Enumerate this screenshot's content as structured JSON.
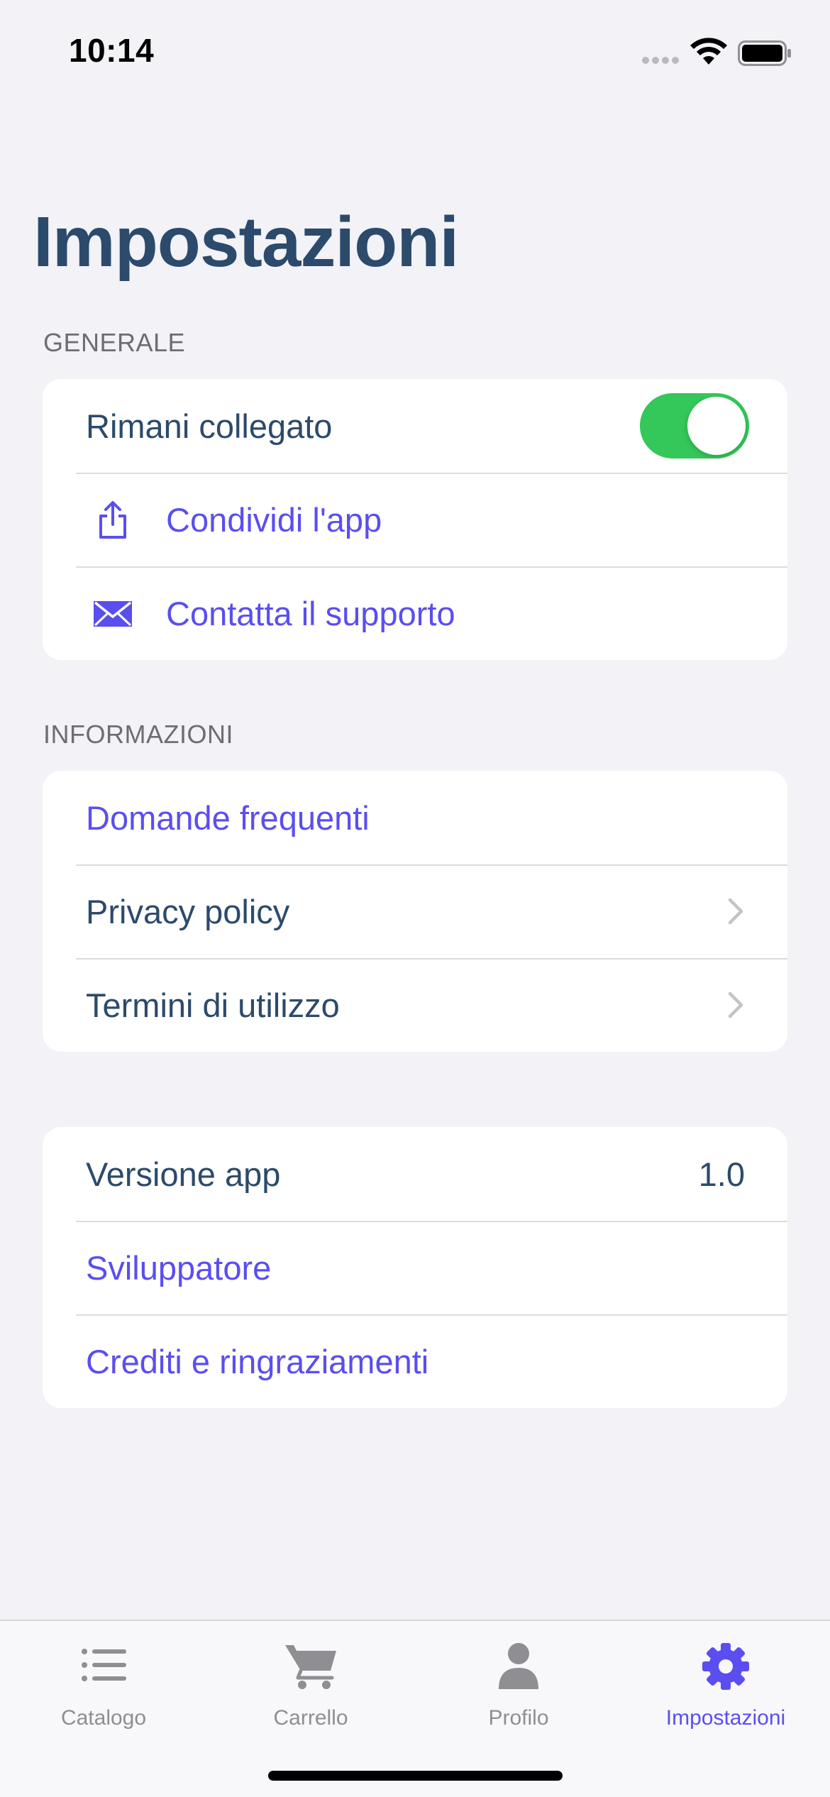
{
  "status_bar": {
    "time": "10:14",
    "icons": [
      "signal-dots-icon",
      "wifi-icon",
      "battery-icon"
    ]
  },
  "page": {
    "title": "Impostazioni"
  },
  "sections": {
    "generale": {
      "header": "GENERALE",
      "stay_logged_in": {
        "label": "Rimani collegato",
        "toggle_on": true
      },
      "share": {
        "label": "Condividi l'app",
        "icon": "share-icon"
      },
      "support": {
        "label": "Contatta il supporto",
        "icon": "envelope-icon"
      }
    },
    "informazioni": {
      "header": "INFORMAZIONI",
      "faq": {
        "label": "Domande frequenti"
      },
      "privacy": {
        "label": "Privacy policy",
        "icon": "chevron-right-icon"
      },
      "terms": {
        "label": "Termini di utilizzo",
        "icon": "chevron-right-icon"
      }
    },
    "about": {
      "version": {
        "label": "Versione app",
        "value": "1.0"
      },
      "developer": {
        "label": "Sviluppatore"
      },
      "credits": {
        "label": "Crediti e ringraziamenti"
      }
    }
  },
  "tab_bar": {
    "tabs": [
      {
        "label": "Catalogo",
        "icon": "list-icon",
        "active": false
      },
      {
        "label": "Carrello",
        "icon": "cart-icon",
        "active": false
      },
      {
        "label": "Profilo",
        "icon": "person-icon",
        "active": false
      },
      {
        "label": "Impostazioni",
        "icon": "gear-icon",
        "active": true
      }
    ]
  },
  "colors": {
    "accent": "#5a4ef0",
    "text_primary": "#2c4a6b",
    "toggle_on": "#34c759",
    "background": "#f2f2f7",
    "tab_inactive": "#8e8e93"
  }
}
